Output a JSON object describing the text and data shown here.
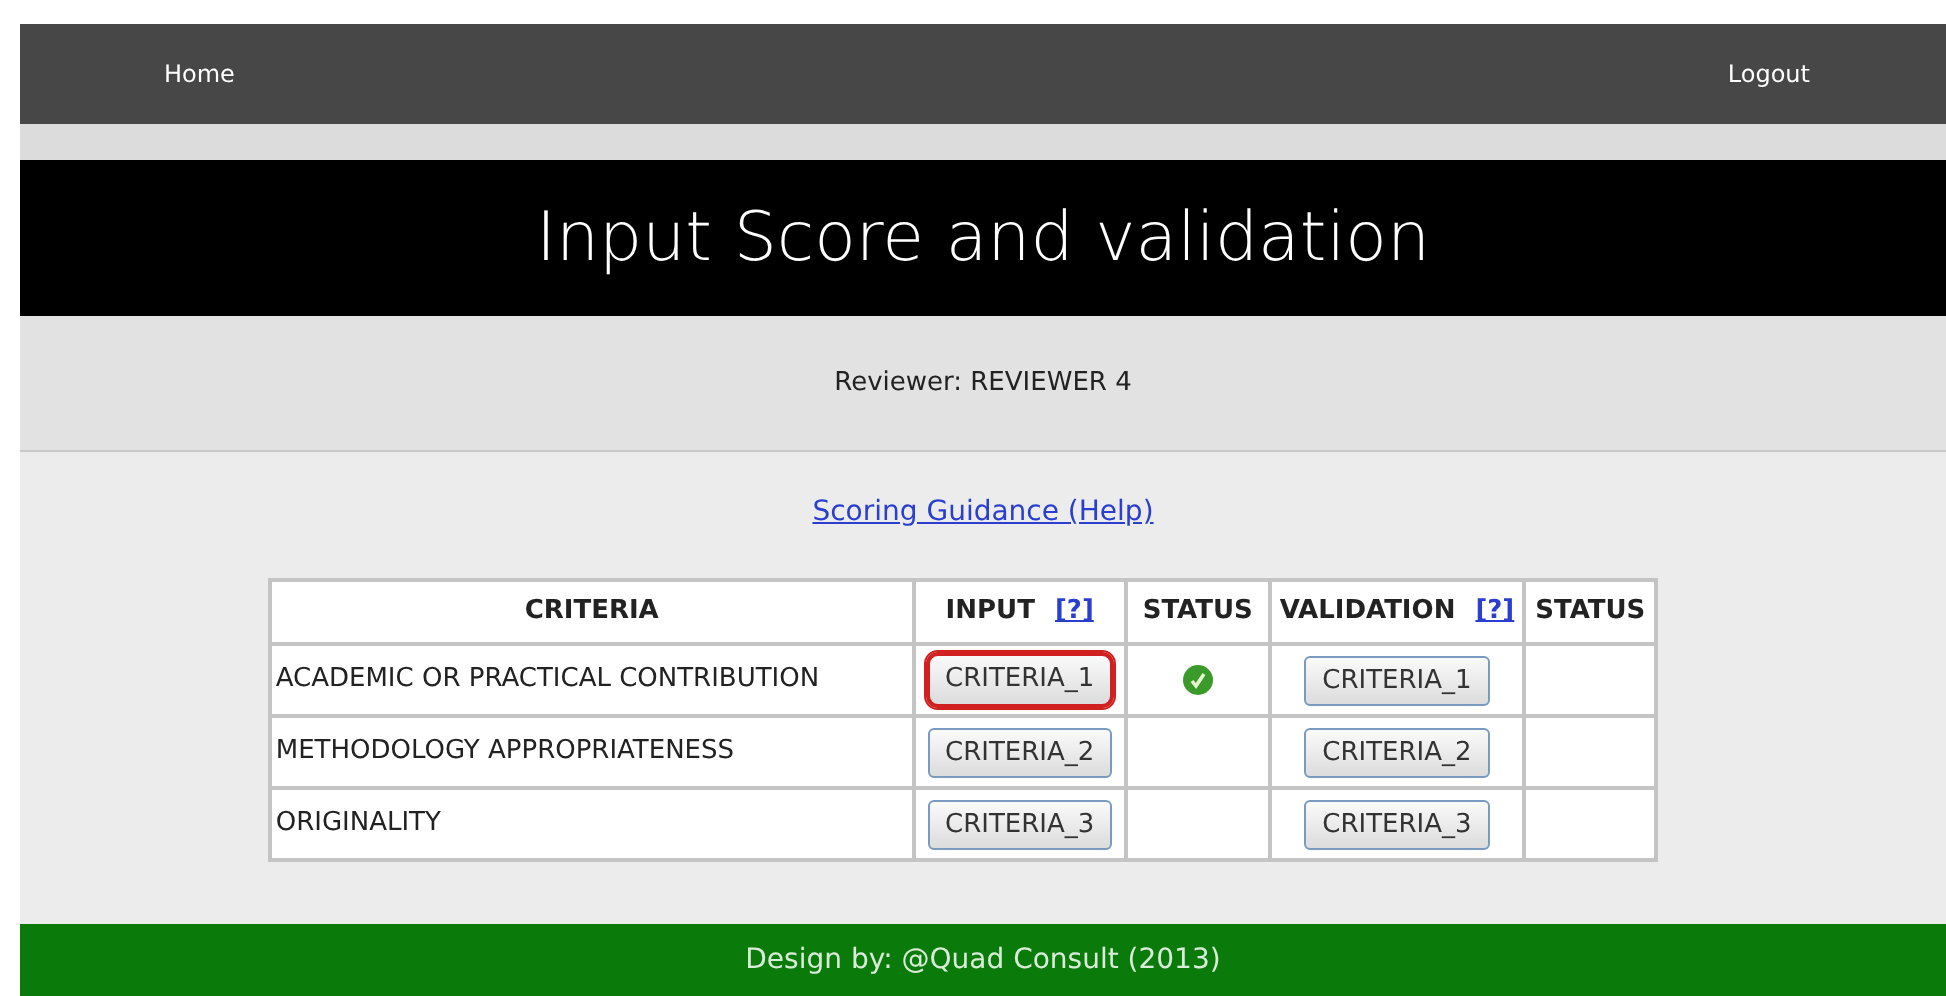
{
  "nav": {
    "left": "Home",
    "right": "Logout"
  },
  "header": {
    "title": "Input Score and validation"
  },
  "reviewer": "Reviewer: REVIEWER 4",
  "help_link": "Scoring Guidance (Help)",
  "table": {
    "columns": [
      {
        "label": "CRITERIA"
      },
      {
        "label": "INPUT",
        "help": "[?]"
      },
      {
        "label": "STATUS"
      },
      {
        "label": "VALIDATION",
        "help": "[?]"
      },
      {
        "label": "STATUS"
      }
    ],
    "rows": [
      {
        "criteria": "ACADEMIC OR PRACTICAL CONTRIBUTION",
        "input": "CRITERIA_1",
        "input_selected": true,
        "input_done": true,
        "validation": "CRITERIA_1"
      },
      {
        "criteria": "METHODOLOGY APPROPRIATENESS",
        "input": "CRITERIA_2",
        "input_selected": false,
        "input_done": false,
        "validation": "CRITERIA_2"
      },
      {
        "criteria": "ORIGINALITY",
        "input": "CRITERIA_3",
        "input_selected": false,
        "input_done": false,
        "validation": "CRITERIA_3"
      }
    ]
  },
  "footer": "Design by: @Quad Consult (2013)"
}
